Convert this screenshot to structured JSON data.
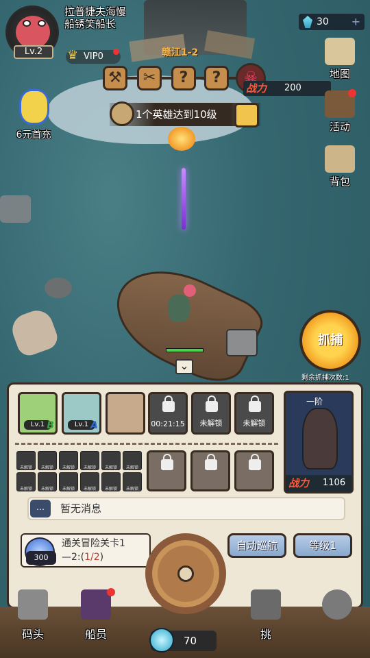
{
  "player": {
    "name": "拉普捷夫海慢船锈笑船长",
    "level": "Lv.2",
    "vip": "VIP0"
  },
  "currency": {
    "gems": "30"
  },
  "stage": {
    "name": "赣江1-2",
    "power_label": "战力",
    "power_value": "200",
    "nodes": [
      "⚒",
      "✂",
      "?",
      "?",
      "☠"
    ]
  },
  "quest": {
    "text": "1个英雄达到10级"
  },
  "first_pay": {
    "label": "6元首充"
  },
  "side_menu": [
    {
      "label": "地图",
      "icon": "map-icon"
    },
    {
      "label": "活动",
      "icon": "ship-icon"
    },
    {
      "label": "背包",
      "icon": "backpack-icon"
    }
  ],
  "catch": {
    "label": "抓捕",
    "remaining": "剩余抓捕次数:1"
  },
  "crew_slots": [
    {
      "level": "Lv.1",
      "grade": "B",
      "grade_color": "#3aa03a"
    },
    {
      "level": "Lv.1",
      "grade": "A",
      "grade_color": "#2a6ad3"
    },
    {
      "level": "",
      "grade": ""
    },
    {
      "caption": "00:21:15"
    },
    {
      "caption": "未解锁"
    },
    {
      "caption": "未解锁"
    }
  ],
  "mini_label": "未解锁",
  "ship": {
    "tier": "一阶",
    "power_label": "战力",
    "power_value": "1106"
  },
  "message": {
    "text": "暂无消息"
  },
  "task": {
    "reward": "300",
    "line1": "通关冒险关卡1",
    "line2_prefix": "—2:(",
    "line2_progress": "1/2",
    "line2_suffix": ")"
  },
  "buttons": {
    "auto_patrol": "自动巡航",
    "level": "等级1"
  },
  "nav": [
    {
      "label": "码头",
      "icon": "castle-icon"
    },
    {
      "label": "船员",
      "icon": "pirate-hat-icon"
    },
    {
      "label": "挑",
      "icon": "crossed-swords-icon"
    },
    {
      "label": "",
      "icon": "money-bag-icon"
    }
  ],
  "energy": {
    "value": "70"
  }
}
